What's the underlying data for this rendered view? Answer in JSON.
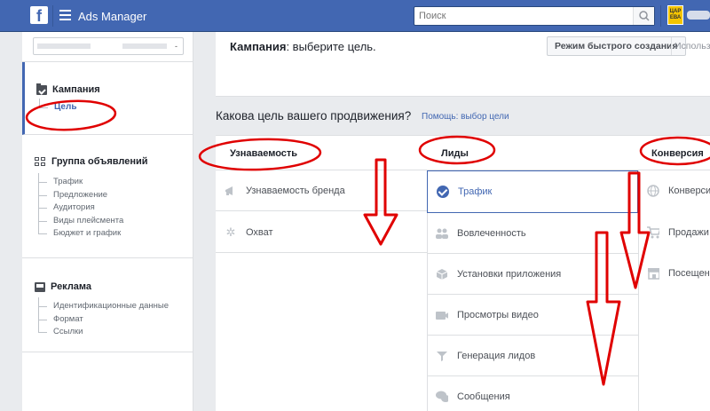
{
  "topbar": {
    "logo_letter": "f",
    "app_title": "Ads Manager",
    "search_placeholder": "Поиск",
    "avatar_text": "ЦАР ЕВА"
  },
  "sidebar": {
    "account_selector_value": "-",
    "sections": [
      {
        "title": "Кампания",
        "items": [
          "Цель"
        ]
      },
      {
        "title": "Группа объявлений",
        "items": [
          "Трафик",
          "Предложение",
          "Аудитория",
          "Виды плейсмента",
          "Бюджет и график"
        ]
      },
      {
        "title": "Реклама",
        "items": [
          "Идентификационные данные",
          "Формат",
          "Ссылки"
        ]
      }
    ]
  },
  "main": {
    "campaign_label": "Кампания",
    "campaign_hint": ": выберите цель.",
    "quick_create_button": "Режим быстрого создания",
    "use_link": "Использ",
    "question": "Какова цель вашего продвижения?",
    "help_link": "Помощь: выбор цели"
  },
  "objectives": [
    {
      "header": "Узнаваемость",
      "options": [
        {
          "label": "Узнаваемость бренда",
          "icon": "megaphone-icon"
        },
        {
          "label": "Охват",
          "icon": "snowflake-icon"
        }
      ]
    },
    {
      "header": "Лиды",
      "options": [
        {
          "label": "Трафик",
          "icon": "check-circle-icon",
          "selected": true
        },
        {
          "label": "Вовлеченность",
          "icon": "people-icon"
        },
        {
          "label": "Установки приложения",
          "icon": "box-icon"
        },
        {
          "label": "Просмотры видео",
          "icon": "video-camera-icon"
        },
        {
          "label": "Генерация лидов",
          "icon": "filter-icon"
        },
        {
          "label": "Сообщения",
          "icon": "chat-bubbles-icon"
        }
      ]
    },
    {
      "header": "Конверсия",
      "options": [
        {
          "label": "Конверси",
          "icon": "globe-icon"
        },
        {
          "label": "Продажи",
          "icon": "cart-icon"
        },
        {
          "label": "Посещен",
          "icon": "store-icon"
        }
      ]
    }
  ],
  "colors": {
    "brand": "#4267b2",
    "annotation": "#e00000"
  }
}
